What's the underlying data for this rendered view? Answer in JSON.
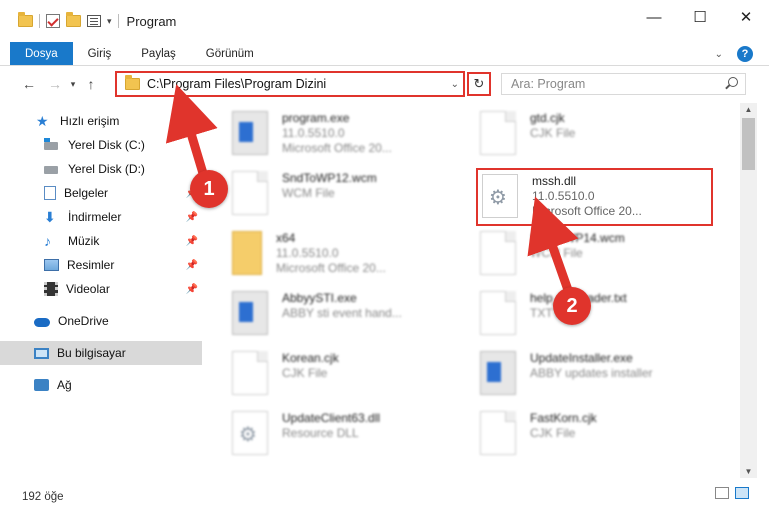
{
  "window": {
    "title": "Program",
    "controls": {
      "minimize": "—",
      "maximize": "☐",
      "close": "✕"
    }
  },
  "ribbon": {
    "tabs": [
      "Dosya",
      "Giriş",
      "Paylaş",
      "Görünüm"
    ],
    "help": "?"
  },
  "address": {
    "path": "C:\\Program Files\\Program Dizini",
    "search_placeholder": "Ara: Program"
  },
  "sidebar": {
    "items": [
      {
        "label": "Hızlı erişim",
        "icon": "star-icon"
      },
      {
        "label": "Yerel Disk (C:)",
        "icon": "drive-icon"
      },
      {
        "label": "Yerel Disk (D:)",
        "icon": "drive-icon"
      },
      {
        "label": "Belgeler",
        "icon": "documents-icon",
        "pinned": true
      },
      {
        "label": "İndirmeler",
        "icon": "downloads-icon",
        "pinned": true
      },
      {
        "label": "Müzik",
        "icon": "music-icon",
        "pinned": true
      },
      {
        "label": "Resimler",
        "icon": "pictures-icon",
        "pinned": true
      },
      {
        "label": "Videolar",
        "icon": "videos-icon",
        "pinned": true
      },
      {
        "label": "OneDrive",
        "icon": "onedrive-icon"
      },
      {
        "label": "Bu bilgisayar",
        "icon": "this-pc-icon",
        "selected": true
      },
      {
        "label": "Ağ",
        "icon": "network-icon"
      }
    ]
  },
  "files": [
    {
      "name": "program.exe",
      "line1": "11.0.5510.0",
      "line2": "Microsoft Office 20..."
    },
    {
      "name": "gtd.cjk",
      "line1": "CJK File",
      "line2": ""
    },
    {
      "name": "SndToWP12.wcm",
      "line1": "WCM File",
      "line2": ""
    },
    {
      "name": "mssh.dll",
      "line1": "11.0.5510.0",
      "line2": "Microsoft Office 20..."
    },
    {
      "name": "x64",
      "line1": "11.0.5510.0",
      "line2": "Microsoft Office 20..."
    },
    {
      "name": "SndToWP14.wcm",
      "line1": "WCM File",
      "line2": ""
    },
    {
      "name": "AbbyySTI.exe",
      "line1": "ABBY sti event hand...",
      "line2": ""
    },
    {
      "name": "help_ru_reader.txt",
      "line1": "TXT File",
      "line2": ""
    },
    {
      "name": "Korean.cjk",
      "line1": "CJK File",
      "line2": ""
    },
    {
      "name": "UpdateInstaller.exe",
      "line1": "ABBY updates installer",
      "line2": ""
    },
    {
      "name": "UpdateClient63.dll",
      "line1": "Resource DLL",
      "line2": ""
    },
    {
      "name": "FastKorn.cjk",
      "line1": "CJK File",
      "line2": ""
    }
  ],
  "status": {
    "count": "192 öğe"
  },
  "annotations": {
    "step1": "1",
    "step2": "2",
    "color": "#e0342c"
  }
}
